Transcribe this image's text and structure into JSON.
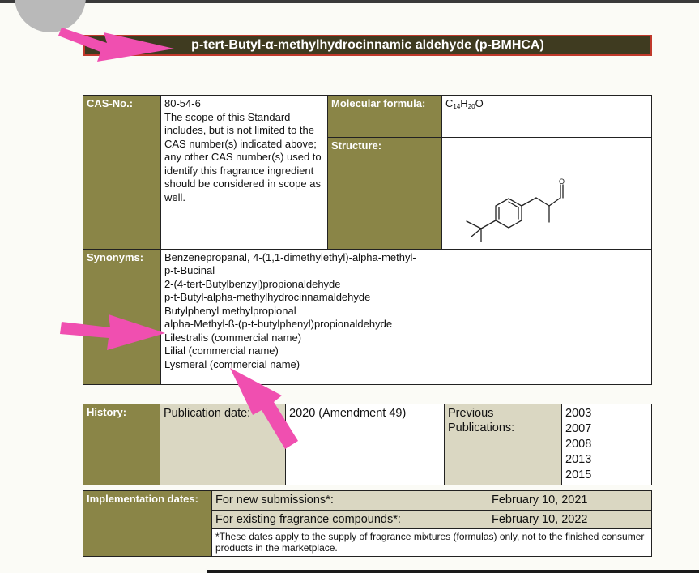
{
  "title": "p-tert-Butyl-α-methylhydrocinnamic aldehyde (p-BMHCA)",
  "cas": {
    "label": "CAS-No.:",
    "number": "80-54-6",
    "scope_note": "The scope of this Standard includes, but is not limited to the CAS number(s) indicated above; any other CAS number(s) used to identify this fragrance ingredient should be considered in scope as well."
  },
  "molecular_formula": {
    "label": "Molecular formula:",
    "c": "C",
    "c_count": "14",
    "h": "H",
    "h_count": "20",
    "o": "O"
  },
  "structure": {
    "label": "Structure:",
    "atom_label": "O"
  },
  "synonyms": {
    "label": "Synonyms:",
    "items": [
      "Benzenepropanal, 4-(1,1-dimethylethyl)-alpha-methyl-",
      "p-t-Bucinal",
      "2-(4-tert-Butylbenzyl)propionaldehyde",
      "p-t-Butyl-alpha-methylhydrocinnamaldehyde",
      "Butylphenyl methylpropional",
      "alpha-Methyl-ß-(p-t-butylphenyl)propionaldehyde",
      "Lilestralis (commercial name)",
      "Lilial (commercial name)",
      "Lysmeral (commercial name)"
    ]
  },
  "history": {
    "label": "History:",
    "pub_date_label": "Publication date:",
    "pub_date_value": "2020 (Amendment 49)",
    "previous_label": "Previous Publications:",
    "years": [
      "2003",
      "2007",
      "2008",
      "2013",
      "2015"
    ]
  },
  "implementation": {
    "label": "Implementation dates:",
    "rows": [
      {
        "label": "For new submissions*:",
        "date": "February 10, 2021"
      },
      {
        "label": "For existing fragrance compounds*:",
        "date": "February 10, 2022"
      }
    ],
    "footnote": "*These dates apply to the supply of fragrance mixtures (formulas) only, not to the finished consumer products in the marketplace."
  },
  "colors": {
    "header_olive": "#8a8547",
    "title_bar": "#3f3b20",
    "tan_cell": "#dad7c2",
    "annotation_arrow": "#f04fb0"
  }
}
